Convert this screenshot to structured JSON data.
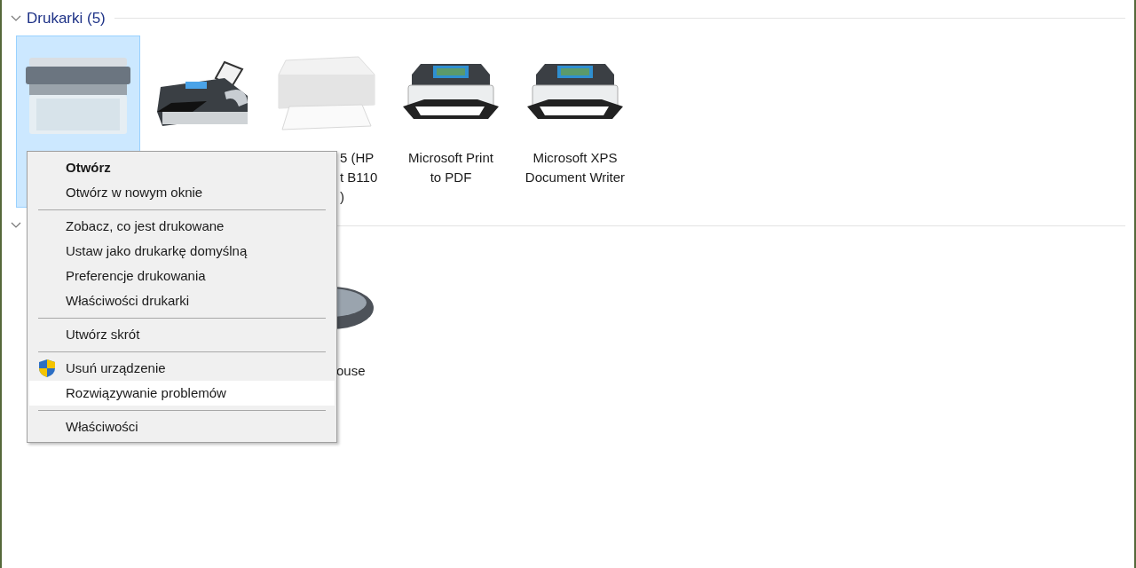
{
  "sections": [
    {
      "title": "Drukarki (5)",
      "expanded": true,
      "items": [
        {
          "kind": "laser",
          "selected": true
        },
        {
          "kind": "fax",
          "selected": false
        },
        {
          "kind": "inkjet",
          "selected": false,
          "label_lines": [
            "5 (HP",
            "t B110",
            ")"
          ]
        },
        {
          "kind": "virtual",
          "selected": false,
          "label_lines": [
            "Microsoft Print",
            "to PDF"
          ]
        },
        {
          "kind": "virtual",
          "selected": false,
          "label_lines": [
            "Microsoft XPS",
            "Document Writer"
          ]
        }
      ]
    },
    {
      "expanded": true,
      "items": [
        {
          "kind": "mouse",
          "selected": false,
          "label_lines": [
            "ouse"
          ]
        }
      ]
    }
  ],
  "context_menu": [
    {
      "kind": "item",
      "label": "Otwórz",
      "default": true,
      "selected": false
    },
    {
      "kind": "item",
      "label": "Otwórz w nowym oknie",
      "default": false,
      "selected": false
    },
    {
      "kind": "separator"
    },
    {
      "kind": "item",
      "label": "Zobacz, co jest drukowane",
      "default": false,
      "selected": false
    },
    {
      "kind": "item",
      "label": "Ustaw jako drukarkę domyślną",
      "default": false,
      "selected": false
    },
    {
      "kind": "item",
      "label": "Preferencje drukowania",
      "default": false,
      "selected": false
    },
    {
      "kind": "item",
      "label": "Właściwości drukarki",
      "default": false,
      "selected": false
    },
    {
      "kind": "separator"
    },
    {
      "kind": "item",
      "label": "Utwórz skrót",
      "default": false,
      "selected": false
    },
    {
      "kind": "separator"
    },
    {
      "kind": "admin",
      "label": "Usuń urządzenie",
      "default": false,
      "selected": false
    },
    {
      "kind": "item",
      "label": "Rozwiązywanie problemów",
      "default": false,
      "selected": true
    },
    {
      "kind": "separator"
    },
    {
      "kind": "item",
      "label": "Właściwości",
      "default": false,
      "selected": false
    }
  ]
}
